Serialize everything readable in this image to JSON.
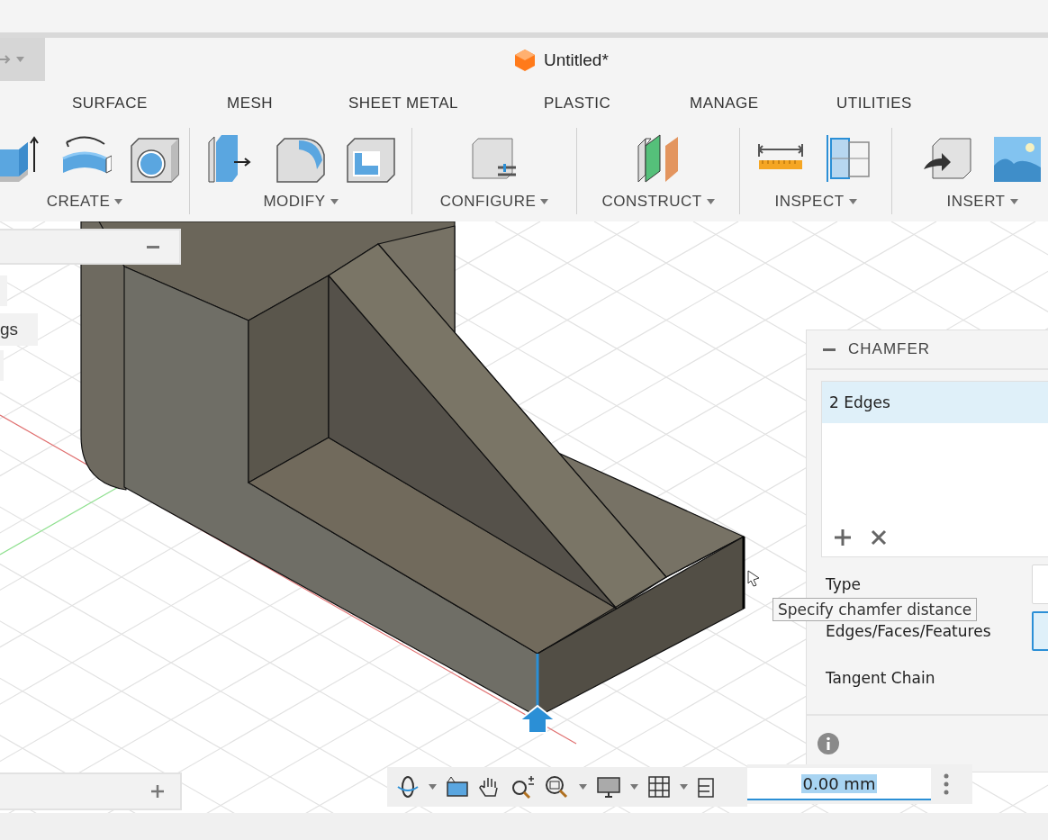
{
  "window": {
    "title": "Untitled*"
  },
  "tabs": [
    {
      "label": "SURFACE"
    },
    {
      "label": "MESH"
    },
    {
      "label": "SHEET METAL"
    },
    {
      "label": "PLASTIC"
    },
    {
      "label": "MANAGE"
    },
    {
      "label": "UTILITIES"
    }
  ],
  "groups": [
    {
      "label": "CREATE",
      "tools": [
        {
          "kind": "extrude"
        },
        {
          "kind": "revolve"
        },
        {
          "kind": "hole"
        }
      ]
    },
    {
      "label": "MODIFY",
      "tools": [
        {
          "kind": "press-pull"
        },
        {
          "kind": "fillet"
        },
        {
          "kind": "shell"
        }
      ]
    },
    {
      "label": "CONFIGURE",
      "tools": [
        {
          "kind": "configure"
        }
      ]
    },
    {
      "label": "CONSTRUCT",
      "tools": [
        {
          "kind": "plane"
        }
      ]
    },
    {
      "label": "INSPECT",
      "tools": [
        {
          "kind": "measure"
        },
        {
          "kind": "interference"
        }
      ]
    },
    {
      "label": "INSERT",
      "tools": [
        {
          "kind": "derive"
        },
        {
          "kind": "decal"
        }
      ]
    }
  ],
  "browser": {
    "items": [
      "gs"
    ]
  },
  "chamfer": {
    "title": "CHAMFER",
    "selection": [
      {
        "label": "2 Edges",
        "selected": true
      }
    ],
    "rows": [
      {
        "label": "Type",
        "kind": "dropdown"
      },
      {
        "label": "Edges/Faces/Features",
        "kind": "select"
      },
      {
        "label": "Tangent Chain",
        "kind": "plain"
      }
    ]
  },
  "tooltip": "Specify chamfer distance",
  "distance": {
    "value": "0.00 mm"
  }
}
